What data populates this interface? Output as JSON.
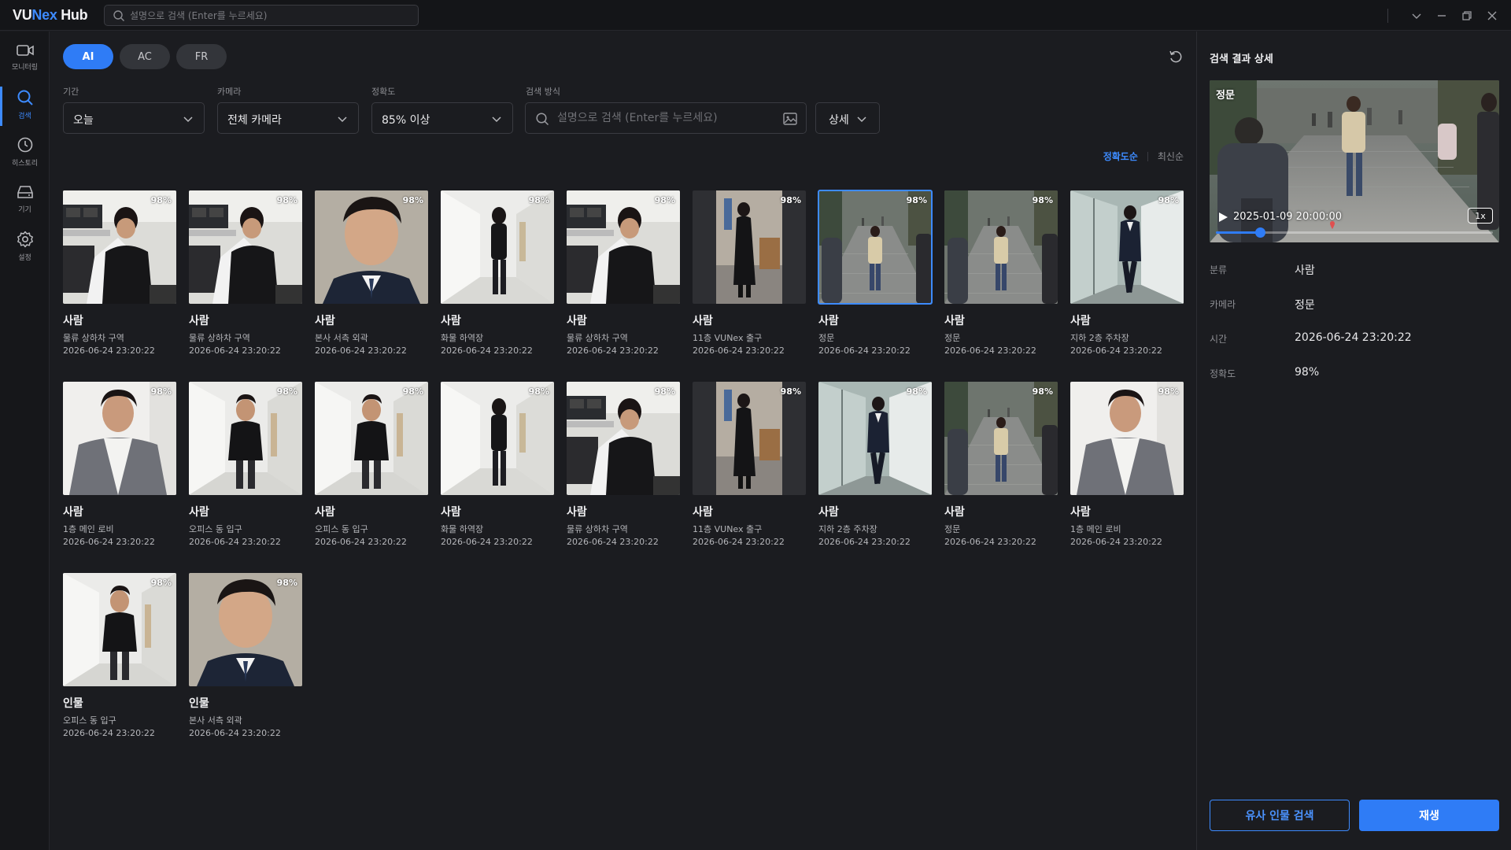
{
  "app": {
    "logo_prefix": "VU",
    "logo_accent": "Nex",
    "logo_suffix": " Hub"
  },
  "top_search": {
    "placeholder": "설명으로 검색 (Enter를 누르세요)"
  },
  "nav": [
    {
      "label": "모니터링",
      "icon": "video-camera-icon",
      "active": false
    },
    {
      "label": "검색",
      "icon": "search-icon",
      "active": true
    },
    {
      "label": "히스토리",
      "icon": "history-icon",
      "active": false
    },
    {
      "label": "기기",
      "icon": "storage-device-icon",
      "active": false
    },
    {
      "label": "설정",
      "icon": "gear-icon",
      "active": false
    }
  ],
  "modes": [
    {
      "label": "AI",
      "active": true
    },
    {
      "label": "AC",
      "active": false
    },
    {
      "label": "FR",
      "active": false
    }
  ],
  "filters": {
    "period": {
      "label": "기간",
      "value": "오늘"
    },
    "camera": {
      "label": "카메라",
      "value": "전체 카메라"
    },
    "accuracy": {
      "label": "정확도",
      "value": "85% 이상"
    },
    "method": {
      "label": "검색 방식",
      "placeholder": "설명으로 검색 (Enter를 누르세요)"
    },
    "detail": "상세"
  },
  "sort": {
    "options": [
      "정확도순",
      "최신순"
    ],
    "active": 0
  },
  "results": [
    {
      "cls": "사람",
      "cam": "물류 상하차 구역",
      "time": "2026-06-24 23:20:22",
      "pct": "98%",
      "scene": "office-man-desk"
    },
    {
      "cls": "사람",
      "cam": "물류 상하차 구역",
      "time": "2026-06-24 23:20:22",
      "pct": "98%",
      "scene": "office-man-desk"
    },
    {
      "cls": "사람",
      "cam": "본사 서측 외곽",
      "time": "2026-06-24 23:20:22",
      "pct": "98%",
      "scene": "portrait-suit"
    },
    {
      "cls": "사람",
      "cam": "화물 하역장",
      "time": "2026-06-24 23:20:22",
      "pct": "98%",
      "scene": "hall-woman"
    },
    {
      "cls": "사람",
      "cam": "물류 상하차 구역",
      "time": "2026-06-24 23:20:22",
      "pct": "98%",
      "scene": "office-man-desk"
    },
    {
      "cls": "사람",
      "cam": "11층 VUNex 출구",
      "time": "2026-06-24 23:20:22",
      "pct": "98%",
      "scene": "lobby-coat"
    },
    {
      "cls": "사람",
      "cam": "정문",
      "time": "2026-06-24 23:20:22",
      "pct": "98%",
      "scene": "street-walk",
      "selected": true
    },
    {
      "cls": "사람",
      "cam": "정문",
      "time": "2026-06-24 23:20:22",
      "pct": "98%",
      "scene": "street-walk"
    },
    {
      "cls": "사람",
      "cam": "지하 2층 주차장",
      "time": "2026-06-24 23:20:22",
      "pct": "98%",
      "scene": "glass-corridor"
    },
    {
      "cls": "사람",
      "cam": "1층 메인 로비",
      "time": "2026-06-24 23:20:22",
      "pct": "98%",
      "scene": "gray-blazer"
    },
    {
      "cls": "사람",
      "cam": "오피스 동 입구",
      "time": "2026-06-24 23:20:22",
      "pct": "98%",
      "scene": "hall-man-black"
    },
    {
      "cls": "사람",
      "cam": "오피스 동 입구",
      "time": "2026-06-24 23:20:22",
      "pct": "98%",
      "scene": "hall-man-black"
    },
    {
      "cls": "사람",
      "cam": "화물 하역장",
      "time": "2026-06-24 23:20:22",
      "pct": "98%",
      "scene": "hall-woman"
    },
    {
      "cls": "사람",
      "cam": "물류 상하차 구역",
      "time": "2026-06-24 23:20:22",
      "pct": "98%",
      "scene": "office-man-desk"
    },
    {
      "cls": "사람",
      "cam": "11층 VUNex 출구",
      "time": "2026-06-24 23:20:22",
      "pct": "98%",
      "scene": "lobby-coat"
    },
    {
      "cls": "사람",
      "cam": "지하 2층 주차장",
      "time": "2026-06-24 23:20:22",
      "pct": "98%",
      "scene": "glass-corridor"
    },
    {
      "cls": "사람",
      "cam": "정문",
      "time": "2026-06-24 23:20:22",
      "pct": "98%",
      "scene": "street-walk"
    },
    {
      "cls": "사람",
      "cam": "1층 메인 로비",
      "time": "2026-06-24 23:20:22",
      "pct": "98%",
      "scene": "gray-blazer"
    },
    {
      "cls": "인물",
      "cam": "오피스 동 입구",
      "time": "2026-06-24 23:20:22",
      "pct": "98%",
      "scene": "hall-man-black"
    },
    {
      "cls": "인물",
      "cam": "본사 서측 외곽",
      "time": "2026-06-24 23:20:22",
      "pct": "98%",
      "scene": "portrait-suit"
    }
  ],
  "detail": {
    "title": "검색 결과 상세",
    "player": {
      "camera": "정문",
      "time": "2025-01-09 20:00:00",
      "speed": "1x",
      "progress": 0.16,
      "marker": 0.42
    },
    "fields": [
      {
        "key": "분류",
        "value": "사람"
      },
      {
        "key": "카메라",
        "value": "정문"
      },
      {
        "key": "시간",
        "value": "2026-06-24 23:20:22"
      },
      {
        "key": "정확도",
        "value": "98%"
      }
    ],
    "similar_button": "유사 인물 검색",
    "play_button": "재생"
  },
  "colors": {
    "accent": "#2f7cf6",
    "bg": "#1b1c20"
  }
}
